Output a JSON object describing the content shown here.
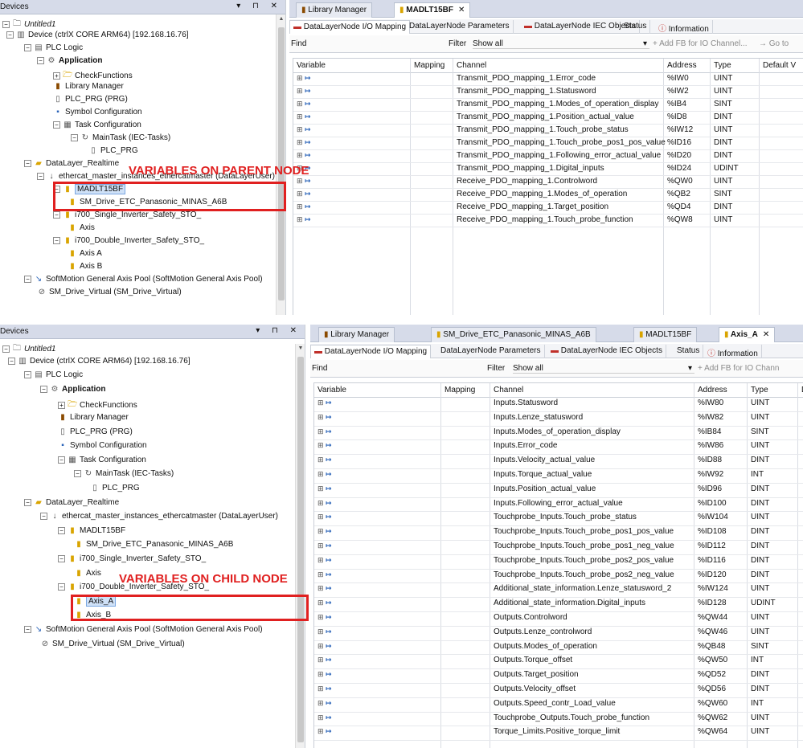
{
  "top": {
    "devices_title": "Devices",
    "tree": [
      {
        "label": "Untitled1",
        "icon": "project-icon",
        "pm": "-",
        "style": "ital"
      },
      {
        "label": "Device (ctrlX CORE ARM64) [192.168.16.76]",
        "icon": "device-icon",
        "pm": "-"
      },
      {
        "label": "PLC Logic",
        "icon": "plc-logic-icon",
        "pm": "-"
      },
      {
        "label": "Application",
        "icon": "application-icon",
        "pm": "-",
        "style": "bold"
      },
      {
        "label": "CheckFunctions",
        "icon": "folder-icon",
        "pm": "+"
      },
      {
        "label": "Library Manager",
        "icon": "library-icon",
        "pm": ""
      },
      {
        "label": "PLC_PRG (PRG)",
        "icon": "program-icon",
        "pm": ""
      },
      {
        "label": "Symbol Configuration",
        "icon": "symbol-icon",
        "pm": ""
      },
      {
        "label": "Task Configuration",
        "icon": "task-icon",
        "pm": "-"
      },
      {
        "label": "MainTask (IEC-Tasks)",
        "icon": "maintask-icon",
        "pm": "-"
      },
      {
        "label": "PLC_PRG",
        "icon": "program-icon",
        "pm": ""
      },
      {
        "label": "DataLayer_Realtime",
        "icon": "datalayer-icon",
        "pm": "-"
      },
      {
        "label": "ethercat_master_instances_ethercatmaster (DataLayerUser)",
        "icon": "ethercat-icon",
        "pm": "-"
      },
      {
        "label": "MADLT15BF",
        "icon": "node-icon",
        "pm": "-",
        "style": "sel"
      },
      {
        "label": "SM_Drive_ETC_Panasonic_MINAS_A6B",
        "icon": "node-icon",
        "pm": ""
      },
      {
        "label": "i700_Single_Inverter_Safety_STO_",
        "icon": "node-icon",
        "pm": "-"
      },
      {
        "label": "Axis",
        "icon": "node-icon",
        "pm": ""
      },
      {
        "label": "i700_Double_Inverter_Safety_STO_",
        "icon": "node-icon",
        "pm": "-"
      },
      {
        "label": "Axis A",
        "icon": "node-icon",
        "pm": ""
      },
      {
        "label": "Axis B",
        "icon": "node-icon",
        "pm": ""
      },
      {
        "label": "SoftMotion General Axis Pool (SoftMotion General Axis Pool)",
        "icon": "axis-pool-icon",
        "pm": "-"
      },
      {
        "label": "SM_Drive_Virtual (SM_Drive_Virtual)",
        "icon": "virtual-drive-icon",
        "pm": ""
      }
    ],
    "doc_tabs": [
      {
        "label": "Library Manager",
        "icon": "library-icon",
        "active": false
      },
      {
        "label": "MADLT15BF",
        "icon": "node-icon",
        "active": true
      }
    ],
    "sub_tabs": [
      "DataLayerNode I/O Mapping",
      "DataLayerNode Parameters",
      "DataLayerNode IEC Objects",
      "Status",
      "Information"
    ],
    "toolbar": {
      "find": "Find",
      "filter": "Filter",
      "filter_value": "Show all",
      "add_fb": "Add FB for IO Channel...",
      "goto": "Go to"
    },
    "columns": [
      "Variable",
      "Mapping",
      "Channel",
      "Address",
      "Type",
      "Default V"
    ],
    "rows": [
      {
        "channel": "Transmit_PDO_mapping_1.Error_code",
        "address": "%IW0",
        "type": "UINT"
      },
      {
        "channel": "Transmit_PDO_mapping_1.Statusword",
        "address": "%IW2",
        "type": "UINT"
      },
      {
        "channel": "Transmit_PDO_mapping_1.Modes_of_operation_display",
        "address": "%IB4",
        "type": "SINT"
      },
      {
        "channel": "Transmit_PDO_mapping_1.Position_actual_value",
        "address": "%ID8",
        "type": "DINT"
      },
      {
        "channel": "Transmit_PDO_mapping_1.Touch_probe_status",
        "address": "%IW12",
        "type": "UINT"
      },
      {
        "channel": "Transmit_PDO_mapping_1.Touch_probe_pos1_pos_value",
        "address": "%ID16",
        "type": "DINT"
      },
      {
        "channel": "Transmit_PDO_mapping_1.Following_error_actual_value",
        "address": "%ID20",
        "type": "DINT"
      },
      {
        "channel": "Transmit_PDO_mapping_1.Digital_inputs",
        "address": "%ID24",
        "type": "UDINT"
      },
      {
        "channel": "Receive_PDO_mapping_1.Controlword",
        "address": "%QW0",
        "type": "UINT"
      },
      {
        "channel": "Receive_PDO_mapping_1.Modes_of_operation",
        "address": "%QB2",
        "type": "SINT"
      },
      {
        "channel": "Receive_PDO_mapping_1.Target_position",
        "address": "%QD4",
        "type": "DINT"
      },
      {
        "channel": "Receive_PDO_mapping_1.Touch_probe_function",
        "address": "%QW8",
        "type": "UINT"
      }
    ],
    "annotation": "VARIABLES ON PARENT NODE"
  },
  "bottom": {
    "devices_title": "Devices",
    "tree": [
      {
        "label": "Untitled1",
        "icon": "project-icon",
        "pm": "-",
        "style": "ital"
      },
      {
        "label": "Device (ctrlX CORE ARM64) [192.168.16.76]",
        "icon": "device-icon",
        "pm": "-"
      },
      {
        "label": "PLC Logic",
        "icon": "plc-logic-icon",
        "pm": "-"
      },
      {
        "label": "Application",
        "icon": "application-icon",
        "pm": "-",
        "style": "bold"
      },
      {
        "label": "CheckFunctions",
        "icon": "folder-icon",
        "pm": "+"
      },
      {
        "label": "Library Manager",
        "icon": "library-icon",
        "pm": ""
      },
      {
        "label": "PLC_PRG (PRG)",
        "icon": "program-icon",
        "pm": ""
      },
      {
        "label": "Symbol Configuration",
        "icon": "symbol-icon",
        "pm": ""
      },
      {
        "label": "Task Configuration",
        "icon": "task-icon",
        "pm": "-"
      },
      {
        "label": "MainTask (IEC-Tasks)",
        "icon": "maintask-icon",
        "pm": "-"
      },
      {
        "label": "PLC_PRG",
        "icon": "program-icon",
        "pm": ""
      },
      {
        "label": "DataLayer_Realtime",
        "icon": "datalayer-icon",
        "pm": "-"
      },
      {
        "label": "ethercat_master_instances_ethercatmaster (DataLayerUser)",
        "icon": "ethercat-icon",
        "pm": "-"
      },
      {
        "label": "MADLT15BF",
        "icon": "node-icon",
        "pm": "-"
      },
      {
        "label": "SM_Drive_ETC_Panasonic_MINAS_A6B",
        "icon": "node-icon",
        "pm": ""
      },
      {
        "label": "i700_Single_Inverter_Safety_STO_",
        "icon": "node-icon",
        "pm": "-"
      },
      {
        "label": "Axis",
        "icon": "node-icon",
        "pm": ""
      },
      {
        "label": "i700_Double_Inverter_Safety_STO_",
        "icon": "node-icon",
        "pm": "-"
      },
      {
        "label": "Axis_A",
        "icon": "node-icon",
        "pm": "",
        "style": "sel"
      },
      {
        "label": "Axis_B",
        "icon": "node-icon",
        "pm": ""
      },
      {
        "label": "SoftMotion General Axis Pool (SoftMotion General Axis Pool)",
        "icon": "axis-pool-icon",
        "pm": "-"
      },
      {
        "label": "SM_Drive_Virtual (SM_Drive_Virtual)",
        "icon": "virtual-drive-icon",
        "pm": ""
      }
    ],
    "doc_tabs": [
      {
        "label": "Library Manager",
        "icon": "library-icon",
        "active": false
      },
      {
        "label": "SM_Drive_ETC_Panasonic_MINAS_A6B",
        "icon": "node-icon",
        "active": false
      },
      {
        "label": "MADLT15BF",
        "icon": "node-icon",
        "active": false
      },
      {
        "label": "Axis_A",
        "icon": "node-icon",
        "active": true
      }
    ],
    "sub_tabs": [
      "DataLayerNode I/O Mapping",
      "DataLayerNode Parameters",
      "DataLayerNode IEC Objects",
      "Status",
      "Information"
    ],
    "toolbar": {
      "find": "Find",
      "filter": "Filter",
      "filter_value": "Show all",
      "add_fb": "Add FB for IO Chann"
    },
    "columns": [
      "Variable",
      "Mapping",
      "Channel",
      "Address",
      "Type",
      "D"
    ],
    "rows": [
      {
        "channel": "Inputs.Statusword",
        "address": "%IW80",
        "type": "UINT"
      },
      {
        "channel": "Inputs.Lenze_statusword",
        "address": "%IW82",
        "type": "UINT"
      },
      {
        "channel": "Inputs.Modes_of_operation_display",
        "address": "%IB84",
        "type": "SINT"
      },
      {
        "channel": "Inputs.Error_code",
        "address": "%IW86",
        "type": "UINT"
      },
      {
        "channel": "Inputs.Velocity_actual_value",
        "address": "%ID88",
        "type": "DINT"
      },
      {
        "channel": "Inputs.Torque_actual_value",
        "address": "%IW92",
        "type": "INT"
      },
      {
        "channel": "Inputs.Position_actual_value",
        "address": "%ID96",
        "type": "DINT"
      },
      {
        "channel": "Inputs.Following_error_actual_value",
        "address": "%ID100",
        "type": "DINT"
      },
      {
        "channel": "Touchprobe_Inputs.Touch_probe_status",
        "address": "%IW104",
        "type": "UINT"
      },
      {
        "channel": "Touchprobe_Inputs.Touch_probe_pos1_pos_value",
        "address": "%ID108",
        "type": "DINT"
      },
      {
        "channel": "Touchprobe_Inputs.Touch_probe_pos1_neg_value",
        "address": "%ID112",
        "type": "DINT"
      },
      {
        "channel": "Touchprobe_Inputs.Touch_probe_pos2_pos_value",
        "address": "%ID116",
        "type": "DINT"
      },
      {
        "channel": "Touchprobe_Inputs.Touch_probe_pos2_neg_value",
        "address": "%ID120",
        "type": "DINT"
      },
      {
        "channel": "Additional_state_information.Lenze_statusword_2",
        "address": "%IW124",
        "type": "UINT"
      },
      {
        "channel": "Additional_state_information.Digital_inputs",
        "address": "%ID128",
        "type": "UDINT"
      },
      {
        "channel": "Outputs.Controlword",
        "address": "%QW44",
        "type": "UINT"
      },
      {
        "channel": "Outputs.Lenze_controlword",
        "address": "%QW46",
        "type": "UINT"
      },
      {
        "channel": "Outputs.Modes_of_operation",
        "address": "%QB48",
        "type": "SINT"
      },
      {
        "channel": "Outputs.Torque_offset",
        "address": "%QW50",
        "type": "INT"
      },
      {
        "channel": "Outputs.Target_position",
        "address": "%QD52",
        "type": "DINT"
      },
      {
        "channel": "Outputs.Velocity_offset",
        "address": "%QD56",
        "type": "DINT"
      },
      {
        "channel": "Outputs.Speed_contr_Load_value",
        "address": "%QW60",
        "type": "INT"
      },
      {
        "channel": "Touchprobe_Outputs.Touch_probe_function",
        "address": "%QW62",
        "type": "UINT"
      },
      {
        "channel": "Torque_Limits.Positive_torque_limit",
        "address": "%QW64",
        "type": "UINT"
      }
    ],
    "annotation": "VARIABLES ON CHILD NODE"
  },
  "colors": {
    "callout": "#e02020",
    "header_bg": "#d6dbe9",
    "selection": "#cfe1f7"
  }
}
